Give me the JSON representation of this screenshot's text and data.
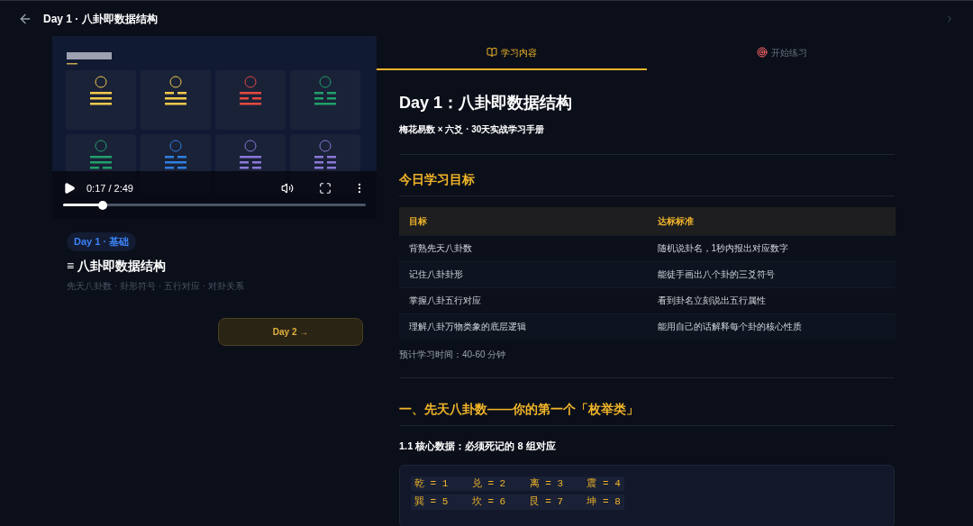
{
  "header": {
    "title": "Day 1 · 八卦即数据结构"
  },
  "video": {
    "time": "0:17 / 2:49",
    "progress": {
      "level": 0.13
    }
  },
  "lesson": {
    "badge": "Day 1 · 基础",
    "title": "≡ 八卦即数据结构",
    "tags": "先天八卦数 · 卦形符号 · 五行对应 · 对卦关系",
    "next_button": "Day 2 →"
  },
  "tabs": [
    {
      "label": "学习内容",
      "selected": true
    },
    {
      "label": "开始练习",
      "selected": false
    }
  ],
  "article": {
    "title": "Day 1：八卦即数据结构",
    "subtitle": "梅花易数 × 六爻 · 30天实战学习手册",
    "goals_heading": "今日学习目标",
    "table": {
      "columns": [
        "目标",
        "达标标准"
      ],
      "rows": [
        [
          "背熟先天八卦数",
          "随机说卦名，1秒内报出对应数字"
        ],
        [
          "记住八卦卦形",
          "能徒手画出八个卦的三爻符号"
        ],
        [
          "掌握八卦五行对应",
          "看到卦名立刻说出五行属性"
        ],
        [
          "理解八卦万物类象的底层逻辑",
          "能用自己的话解释每个卦的核心性质"
        ]
      ]
    },
    "time_note": "预计学习时间：40-60 分钟",
    "section_heading": "一、先天八卦数——你的第一个「枚举类」",
    "subsection_heading": "1.1 核心数据：必须死记的 8 组对应",
    "code_lines": [
      "乾 = 1    兑 = 2    离 = 3    震 = 4",
      "巽 = 5    坎 = 6    艮 = 7    坤 = 8"
    ]
  }
}
